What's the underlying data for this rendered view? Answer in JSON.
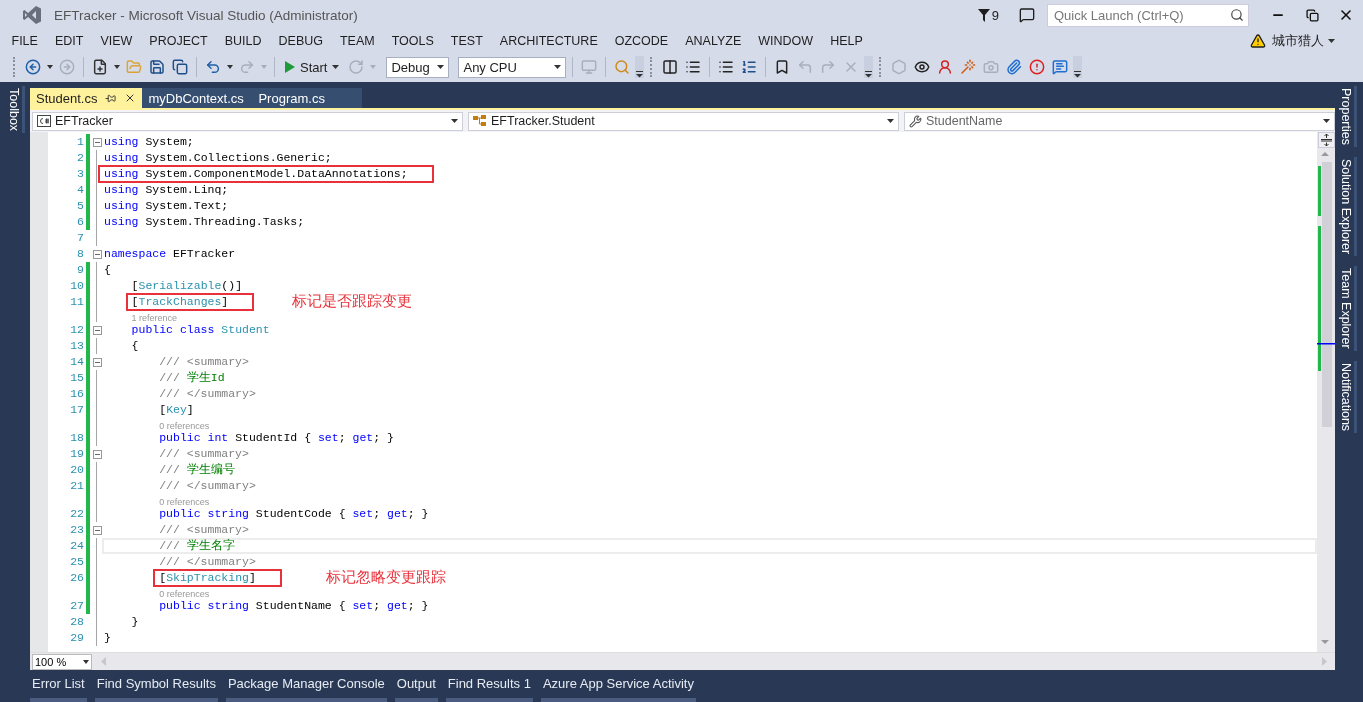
{
  "window": {
    "title": "EFTracker - Microsoft Visual Studio (Administrator)",
    "notification_count": "9",
    "quick_launch": {
      "placeholder": "Quick Launch (Ctrl+Q)"
    }
  },
  "menu": [
    "FILE",
    "EDIT",
    "VIEW",
    "PROJECT",
    "BUILD",
    "DEBUG",
    "TEAM",
    "TOOLS",
    "TEST",
    "ARCHITECTURE",
    "OZCODE",
    "ANALYZE",
    "WINDOW",
    "HELP"
  ],
  "user": {
    "name": "城市猎人"
  },
  "toolbar": [
    {
      "kind": "grip"
    },
    {
      "kind": "icon",
      "disabled": false
    },
    {
      "kind": "caret",
      "disabled": false
    },
    {
      "kind": "icon",
      "disabled": true
    },
    {
      "kind": "sep"
    },
    {
      "kind": "icon",
      "disabled": false
    },
    {
      "kind": "caret",
      "disabled": false
    },
    {
      "kind": "icon",
      "disabled": false
    },
    {
      "kind": "icon",
      "disabled": false
    },
    {
      "kind": "icon",
      "disabled": false
    },
    {
      "kind": "sep"
    },
    {
      "kind": "icon",
      "disabled": false
    },
    {
      "kind": "caret",
      "disabled": false
    },
    {
      "kind": "icon",
      "disabled": true
    },
    {
      "kind": "caret",
      "disabled": true
    },
    {
      "kind": "sep"
    },
    {
      "kind": "start",
      "label": "Start"
    },
    {
      "kind": "icon",
      "disabled": true
    },
    {
      "kind": "caret",
      "disabled": true
    },
    {
      "kind": "dropdown",
      "value": "Debug"
    },
    {
      "kind": "dropdown",
      "value": "Any CPU"
    },
    {
      "kind": "sep"
    },
    {
      "kind": "icon",
      "disabled": true
    },
    {
      "kind": "sep"
    },
    {
      "kind": "icon",
      "disabled": false
    },
    {
      "kind": "overflow"
    },
    {
      "kind": "grip"
    },
    {
      "kind": "icon",
      "disabled": false
    },
    {
      "kind": "icon",
      "disabled": false
    },
    {
      "kind": "sep"
    },
    {
      "kind": "icon",
      "disabled": false
    },
    {
      "kind": "icon",
      "disabled": false
    },
    {
      "kind": "sep"
    },
    {
      "kind": "icon",
      "disabled": false
    },
    {
      "kind": "icon",
      "disabled": true
    },
    {
      "kind": "icon",
      "disabled": true
    },
    {
      "kind": "icon",
      "disabled": true
    },
    {
      "kind": "overflow"
    },
    {
      "kind": "grip"
    },
    {
      "kind": "icon",
      "disabled": true
    },
    {
      "kind": "icon",
      "disabled": false
    },
    {
      "kind": "icon",
      "disabled": false
    },
    {
      "kind": "icon",
      "disabled": false
    },
    {
      "kind": "icon",
      "disabled": true
    },
    {
      "kind": "icon",
      "disabled": false
    },
    {
      "kind": "icon",
      "disabled": false
    },
    {
      "kind": "icon",
      "disabled": false
    },
    {
      "kind": "overflow"
    }
  ],
  "left_panels": [
    "Toolbox"
  ],
  "right_panels": [
    "Properties",
    "Solution Explorer",
    "Team Explorer",
    "Notifications"
  ],
  "tabs": [
    {
      "label": "Student.cs",
      "selected": true
    },
    {
      "label": "myDbContext.cs",
      "selected": false
    },
    {
      "label": "Program.cs",
      "selected": false
    }
  ],
  "navigation": [
    {
      "kind": "project",
      "value": "EFTracker"
    },
    {
      "kind": "type",
      "value": "EFTracker.Student"
    },
    {
      "kind": "member",
      "value": "StudentName"
    }
  ],
  "code": [
    {
      "num": "1",
      "collapsible": true,
      "changed": true,
      "current": false,
      "boxed": false,
      "tokens": [
        {
          "kind": "kw",
          "text": "using"
        },
        {
          "kind": "text",
          "text": " System;"
        }
      ]
    },
    {
      "num": "2",
      "collapsible": false,
      "changed": true,
      "current": false,
      "boxed": false,
      "tokens": [
        {
          "kind": "kw",
          "text": "using"
        },
        {
          "kind": "text",
          "text": " System.Collections.Generic;"
        }
      ]
    },
    {
      "num": "3",
      "collapsible": false,
      "changed": true,
      "current": false,
      "boxed": true,
      "tokens": [
        {
          "kind": "kw",
          "text": "using"
        },
        {
          "kind": "text",
          "text": " System.ComponentModel.DataAnnotations;"
        }
      ]
    },
    {
      "num": "4",
      "collapsible": false,
      "changed": true,
      "current": false,
      "boxed": false,
      "tokens": [
        {
          "kind": "kw",
          "text": "using"
        },
        {
          "kind": "text",
          "text": " System.Linq;"
        }
      ]
    },
    {
      "num": "5",
      "collapsible": false,
      "changed": true,
      "current": false,
      "boxed": false,
      "tokens": [
        {
          "kind": "kw",
          "text": "using"
        },
        {
          "kind": "text",
          "text": " System.Text;"
        }
      ]
    },
    {
      "num": "6",
      "collapsible": false,
      "changed": true,
      "current": false,
      "boxed": false,
      "tokens": [
        {
          "kind": "kw",
          "text": "using"
        },
        {
          "kind": "text",
          "text": " System.Threading.Tasks;"
        }
      ]
    },
    {
      "num": "7",
      "collapsible": false,
      "changed": false,
      "current": false,
      "boxed": false
    },
    {
      "num": "8",
      "collapsible": true,
      "changed": false,
      "current": false,
      "boxed": false,
      "tokens": [
        {
          "kind": "kw",
          "text": "namespace"
        },
        {
          "kind": "text",
          "text": " EFTracker"
        }
      ]
    },
    {
      "num": "9",
      "collapsible": false,
      "changed": true,
      "current": false,
      "boxed": false,
      "tokens": [
        {
          "kind": "text",
          "text": "{"
        }
      ]
    },
    {
      "num": "10",
      "collapsible": false,
      "changed": true,
      "current": false,
      "boxed": false,
      "tokens": [
        {
          "kind": "text",
          "text": "    ["
        },
        {
          "kind": "type",
          "text": "Serializable"
        },
        {
          "kind": "text",
          "text": "()]"
        }
      ]
    },
    {
      "num": "11",
      "collapsible": false,
      "changed": true,
      "current": false,
      "boxed": true,
      "note": "标记是否跟踪变更",
      "tokens": [
        {
          "kind": "text",
          "text": "    ["
        },
        {
          "kind": "type",
          "text": "TrackChanges"
        },
        {
          "kind": "text",
          "text": "]"
        }
      ]
    },
    {
      "num": "12",
      "collapsible": true,
      "changed": true,
      "current": false,
      "boxed": false,
      "lens": "1 reference",
      "tokens": [
        {
          "kind": "kw",
          "text": "    public"
        },
        {
          "kind": "kw",
          "text": " class"
        },
        {
          "kind": "type",
          "text": " Student"
        }
      ]
    },
    {
      "num": "13",
      "collapsible": false,
      "changed": true,
      "current": false,
      "boxed": false,
      "tokens": [
        {
          "kind": "text",
          "text": "    {"
        }
      ]
    },
    {
      "num": "14",
      "collapsible": true,
      "changed": true,
      "current": false,
      "boxed": false,
      "tokens": [
        {
          "kind": "doc",
          "text": "        /// <summary>"
        }
      ]
    },
    {
      "num": "15",
      "collapsible": false,
      "changed": true,
      "current": false,
      "boxed": false,
      "tokens": [
        {
          "kind": "doc",
          "text": "        ///"
        },
        {
          "kind": "comment",
          "text": " 学生Id"
        }
      ]
    },
    {
      "num": "16",
      "collapsible": false,
      "changed": true,
      "current": false,
      "boxed": false,
      "tokens": [
        {
          "kind": "doc",
          "text": "        /// </summary>"
        }
      ]
    },
    {
      "num": "17",
      "collapsible": false,
      "changed": true,
      "current": false,
      "boxed": false,
      "tokens": [
        {
          "kind": "text",
          "text": "        ["
        },
        {
          "kind": "type",
          "text": "Key"
        },
        {
          "kind": "text",
          "text": "]"
        }
      ]
    },
    {
      "num": "18",
      "collapsible": false,
      "changed": true,
      "current": false,
      "boxed": false,
      "lens": "0 references",
      "tokens": [
        {
          "kind": "kw",
          "text": "        public"
        },
        {
          "kind": "kw",
          "text": " int"
        },
        {
          "kind": "text",
          "text": " StudentId {"
        },
        {
          "kind": "kw",
          "text": " set"
        },
        {
          "kind": "text",
          "text": ";"
        },
        {
          "kind": "kw",
          "text": " get"
        },
        {
          "kind": "text",
          "text": "; }"
        }
      ]
    },
    {
      "num": "19",
      "collapsible": true,
      "changed": true,
      "current": false,
      "boxed": false,
      "tokens": [
        {
          "kind": "doc",
          "text": "        /// <summary>"
        }
      ]
    },
    {
      "num": "20",
      "collapsible": false,
      "changed": true,
      "current": false,
      "boxed": false,
      "tokens": [
        {
          "kind": "doc",
          "text": "        ///"
        },
        {
          "kind": "comment",
          "text": " 学生编号"
        }
      ]
    },
    {
      "num": "21",
      "collapsible": false,
      "changed": true,
      "current": false,
      "boxed": false,
      "tokens": [
        {
          "kind": "doc",
          "text": "        /// </summary>"
        }
      ]
    },
    {
      "num": "22",
      "collapsible": false,
      "changed": true,
      "current": false,
      "boxed": false,
      "lens": "0 references",
      "tokens": [
        {
          "kind": "kw",
          "text": "        public"
        },
        {
          "kind": "kw",
          "text": " string"
        },
        {
          "kind": "text",
          "text": " StudentCode {"
        },
        {
          "kind": "kw",
          "text": " set"
        },
        {
          "kind": "text",
          "text": ";"
        },
        {
          "kind": "kw",
          "text": " get"
        },
        {
          "kind": "text",
          "text": "; }"
        }
      ]
    },
    {
      "num": "23",
      "collapsible": true,
      "changed": true,
      "current": false,
      "boxed": false,
      "tokens": [
        {
          "kind": "doc",
          "text": "        /// <summary>"
        }
      ]
    },
    {
      "num": "24",
      "collapsible": false,
      "changed": true,
      "current": true,
      "boxed": false,
      "tokens": [
        {
          "kind": "doc",
          "text": "        ///"
        },
        {
          "kind": "comment",
          "text": " 学生名字"
        }
      ]
    },
    {
      "num": "25",
      "collapsible": false,
      "changed": true,
      "current": false,
      "boxed": false,
      "tokens": [
        {
          "kind": "doc",
          "text": "        /// </summary>"
        }
      ]
    },
    {
      "num": "26",
      "collapsible": false,
      "changed": true,
      "current": false,
      "boxed": true,
      "note": "标记忽略变更跟踪",
      "tokens": [
        {
          "kind": "text",
          "text": "        ["
        },
        {
          "kind": "type",
          "text": "SkipTracking"
        },
        {
          "kind": "text",
          "text": "]"
        }
      ]
    },
    {
      "num": "27",
      "collapsible": false,
      "changed": true,
      "current": false,
      "boxed": false,
      "lens": "0 references",
      "tokens": [
        {
          "kind": "kw",
          "text": "        public"
        },
        {
          "kind": "kw",
          "text": " string"
        },
        {
          "kind": "text",
          "text": " StudentName {"
        },
        {
          "kind": "kw",
          "text": " set"
        },
        {
          "kind": "text",
          "text": ";"
        },
        {
          "kind": "kw",
          "text": " get"
        },
        {
          "kind": "text",
          "text": "; }"
        }
      ]
    },
    {
      "num": "28",
      "collapsible": false,
      "changed": false,
      "current": false,
      "boxed": false,
      "tokens": [
        {
          "kind": "text",
          "text": "    }"
        }
      ]
    },
    {
      "num": "29",
      "collapsible": false,
      "changed": false,
      "current": false,
      "boxed": false,
      "tokens": [
        {
          "kind": "text",
          "text": "}"
        }
      ]
    }
  ],
  "zoom": "100 %",
  "bottom_tabs": [
    "Error List",
    "Find Symbol Results",
    "Package Manager Console",
    "Output",
    "Find Results 1",
    "Azure App Service Activity"
  ]
}
